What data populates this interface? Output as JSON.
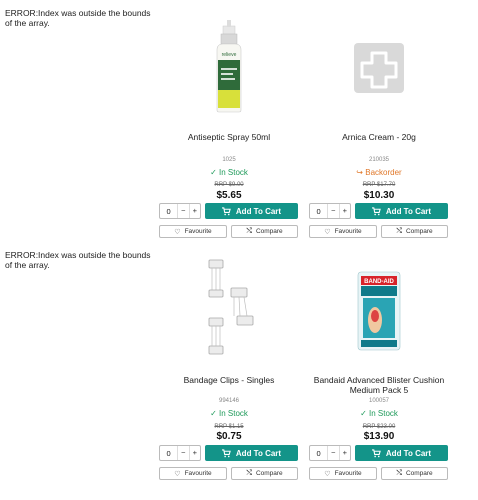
{
  "errors": [
    "ERROR:Index was outside the bounds of the array.",
    "ERROR:Index was outside the bounds of the array."
  ],
  "buttons": {
    "add_to_cart": "Add To Cart",
    "favourite": "Favourite",
    "compare": "Compare"
  },
  "products": [
    {
      "title": "Antiseptic Spray 50ml",
      "sku": "1025",
      "stock": "In Stock",
      "stock_icon": "check-icon",
      "rrp": "RRP $9.00",
      "price": "$5.65",
      "qty": "0",
      "image": "antiseptic-spray-bottle",
      "label": "relieve"
    },
    {
      "title": "Arnica Cream - 20g",
      "sku": "210035",
      "stock": "Backorder",
      "stock_icon": "backorder-icon",
      "rrp": "RRP $17.70",
      "price": "$10.30",
      "qty": "0",
      "image": "placeholder-medical-cross"
    },
    {
      "title": "Bandage Clips - Singles",
      "sku": "994146",
      "stock": "In Stock",
      "stock_icon": "check-icon",
      "rrp": "RRP $1.15",
      "price": "$0.75",
      "qty": "0",
      "image": "bandage-clips"
    },
    {
      "title": "Bandaid Advanced Blister Cushion Medium Pack 5",
      "sku": "100057",
      "stock": "In Stock",
      "stock_icon": "check-icon",
      "rrp": "RRP $23.00",
      "price": "$13.90",
      "qty": "0",
      "image": "band-aid-box",
      "label": "BAND-AID"
    }
  ],
  "colors": {
    "teal": "#139489",
    "in_stock": "#1e9a5a",
    "backorder": "#e0782a"
  }
}
